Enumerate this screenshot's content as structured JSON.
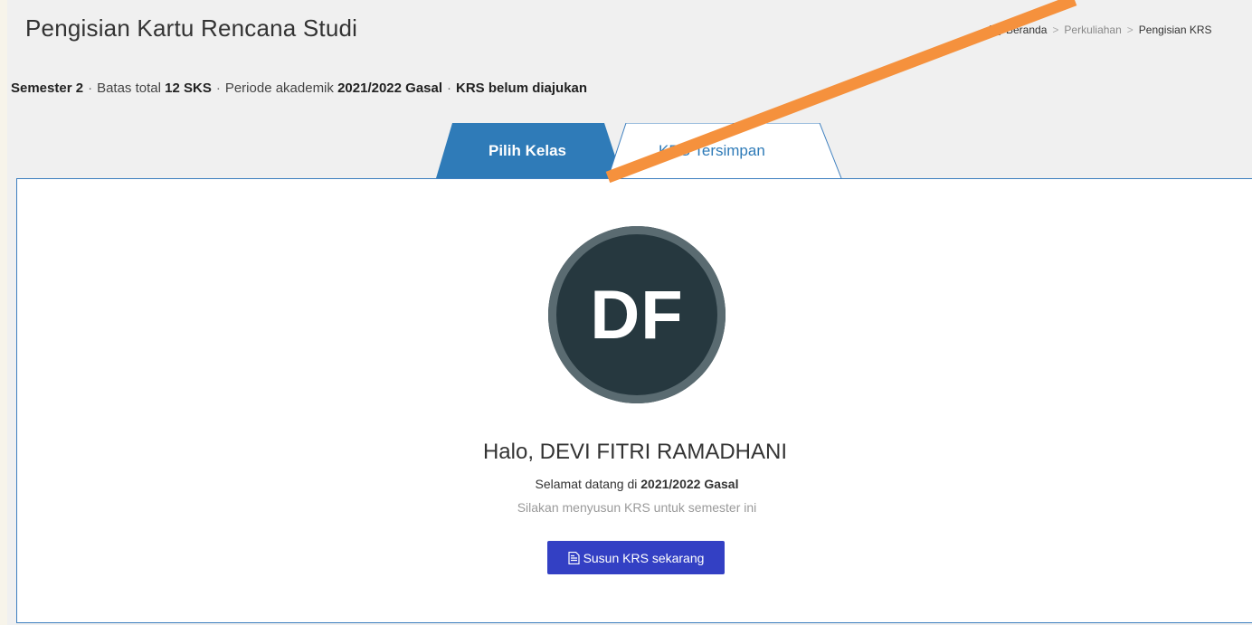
{
  "header": {
    "title": "Pengisian Kartu Rencana Studi"
  },
  "breadcrumb": {
    "home": "Beranda",
    "separator": ">",
    "middle": "Perkuliahan",
    "current": "Pengisian KRS"
  },
  "info": {
    "semester_label": "Semester 2",
    "dot": "·",
    "limit_prefix": "Batas total",
    "limit_value": "12 SKS",
    "period_prefix": "Periode akademik",
    "period_value": "2021/2022 Gasal",
    "status": "KRS belum diajukan"
  },
  "tabs": [
    {
      "label": "Pilih Kelas",
      "active": true
    },
    {
      "label": "KRS Tersimpan",
      "active": false
    }
  ],
  "profile": {
    "initials": "DF",
    "greeting": "Halo, DEVI FITRI RAMADHANI",
    "welcome_prefix": "Selamat datang di",
    "welcome_period": "2021/2022 Gasal",
    "instruction": "Silakan menyusun KRS untuk semester ini",
    "button_label": "Susun KRS sekarang"
  },
  "colors": {
    "tab_active": "#2f7bb8",
    "panel_border": "#3d7fbf",
    "avatar_bg": "#26383f",
    "avatar_ring": "#5a6b71",
    "button_bg": "#3340c4",
    "annotation_arrow": "#f5913d"
  },
  "icons": {
    "breadcrumb_home": "home-icon",
    "button": "document-icon"
  }
}
